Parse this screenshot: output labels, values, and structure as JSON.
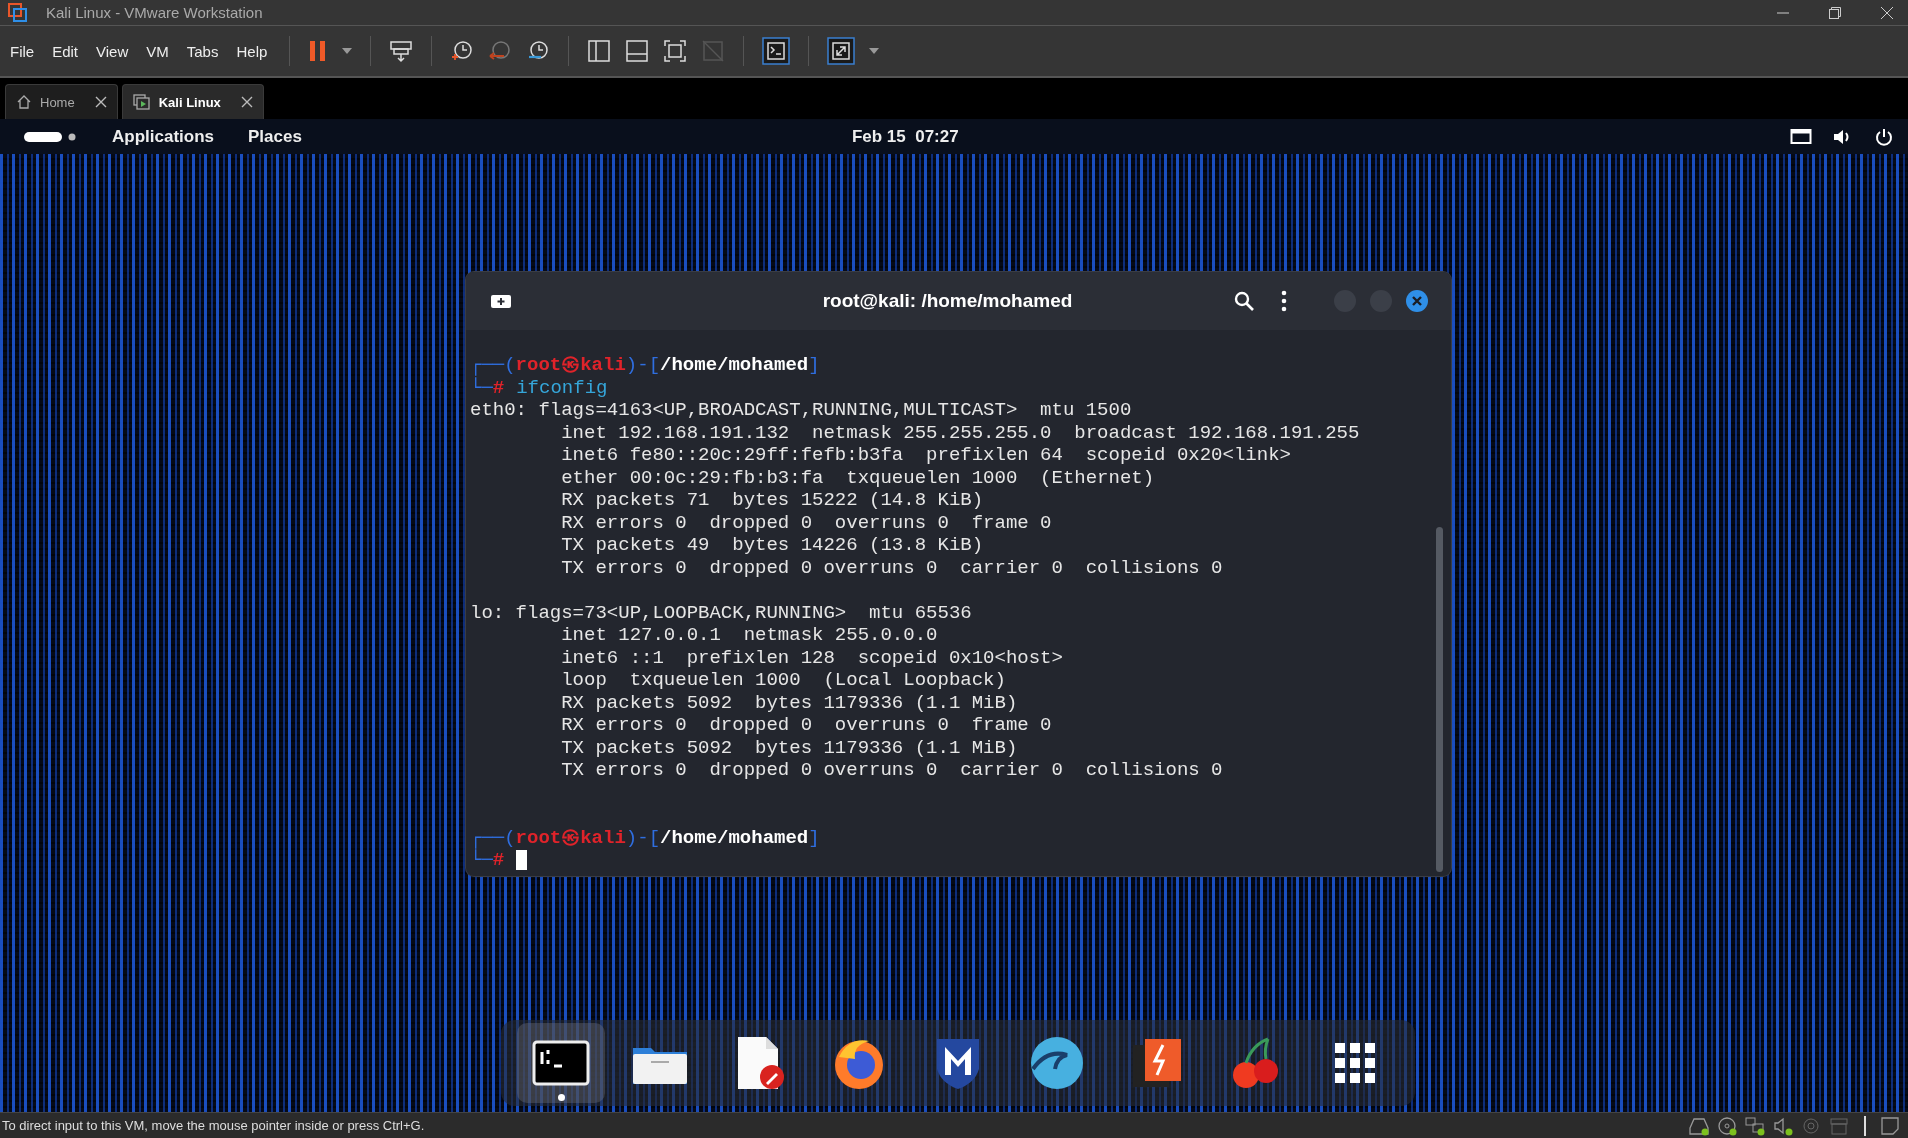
{
  "window": {
    "title": "Kali Linux - VMware Workstation"
  },
  "menu": [
    "File",
    "Edit",
    "View",
    "VM",
    "Tabs",
    "Help"
  ],
  "tabs": [
    {
      "label": "Home",
      "selected": false
    },
    {
      "label": "Kali Linux",
      "selected": true
    }
  ],
  "guest_bar": {
    "menus": [
      "Applications",
      "Places"
    ],
    "clock": "Feb 15  07:27"
  },
  "terminal": {
    "title": "root@kali: /home/mohamed",
    "lines": [
      {
        "kind": "prompt",
        "open": "┌──(",
        "user": "root",
        "at": "㉿",
        "host": "kali",
        "mid": ")-[",
        "path": "/home/mohamed",
        "close": "]"
      },
      {
        "kind": "command",
        "branch": "└─",
        "mark": "#",
        "command": "ifconfig"
      },
      {
        "kind": "output",
        "text": "eth0: flags=4163<UP,BROADCAST,RUNNING,MULTICAST>  mtu 1500"
      },
      {
        "kind": "output",
        "text": "        inet 192.168.191.132  netmask 255.255.255.0  broadcast 192.168.191.255"
      },
      {
        "kind": "output",
        "text": "        inet6 fe80::20c:29ff:fefb:b3fa  prefixlen 64  scopeid 0x20<link>"
      },
      {
        "kind": "output",
        "text": "        ether 00:0c:29:fb:b3:fa  txqueuelen 1000  (Ethernet)"
      },
      {
        "kind": "output",
        "text": "        RX packets 71  bytes 15222 (14.8 KiB)"
      },
      {
        "kind": "output",
        "text": "        RX errors 0  dropped 0  overruns 0  frame 0"
      },
      {
        "kind": "output",
        "text": "        TX packets 49  bytes 14226 (13.8 KiB)"
      },
      {
        "kind": "output",
        "text": "        TX errors 0  dropped 0 overruns 0  carrier 0  collisions 0"
      },
      {
        "kind": "blank"
      },
      {
        "kind": "output",
        "text": "lo: flags=73<UP,LOOPBACK,RUNNING>  mtu 65536"
      },
      {
        "kind": "output",
        "text": "        inet 127.0.0.1  netmask 255.0.0.0"
      },
      {
        "kind": "output",
        "text": "        inet6 ::1  prefixlen 128  scopeid 0x10<host>"
      },
      {
        "kind": "output",
        "text": "        loop  txqueuelen 1000  (Local Loopback)"
      },
      {
        "kind": "output",
        "text": "        RX packets 5092  bytes 1179336 (1.1 MiB)"
      },
      {
        "kind": "output",
        "text": "        RX errors 0  dropped 0  overruns 0  frame 0"
      },
      {
        "kind": "output",
        "text": "        TX packets 5092  bytes 1179336 (1.1 MiB)"
      },
      {
        "kind": "output",
        "text": "        TX errors 0  dropped 0 overruns 0  carrier 0  collisions 0"
      },
      {
        "kind": "blank"
      },
      {
        "kind": "blank"
      },
      {
        "kind": "prompt",
        "open": "┌──(",
        "user": "root",
        "at": "㉿",
        "host": "kali",
        "mid": ")-[",
        "path": "/home/mohamed",
        "close": "]"
      },
      {
        "kind": "command",
        "branch": "└─",
        "mark": "#",
        "cursor": true
      }
    ]
  },
  "dock": [
    {
      "kind": "terminal",
      "running": true
    },
    {
      "kind": "files",
      "running": false
    },
    {
      "kind": "editor",
      "running": false
    },
    {
      "kind": "browser",
      "running": false
    },
    {
      "kind": "shield",
      "running": false
    },
    {
      "kind": "shark",
      "running": false
    },
    {
      "kind": "burp",
      "running": false
    },
    {
      "kind": "cherry",
      "running": false
    },
    {
      "kind": "apps",
      "running": false
    }
  ],
  "status_bar": {
    "message": "To direct input to this VM, move the mouse pointer inside or press Ctrl+G.",
    "devices": [
      {
        "kind": "disk",
        "connected": true
      },
      {
        "kind": "cd",
        "connected": true
      },
      {
        "kind": "network",
        "connected": true
      },
      {
        "kind": "sound",
        "connected": true
      },
      {
        "kind": "camera",
        "connected": false
      },
      {
        "kind": "printer",
        "connected": false
      }
    ]
  }
}
